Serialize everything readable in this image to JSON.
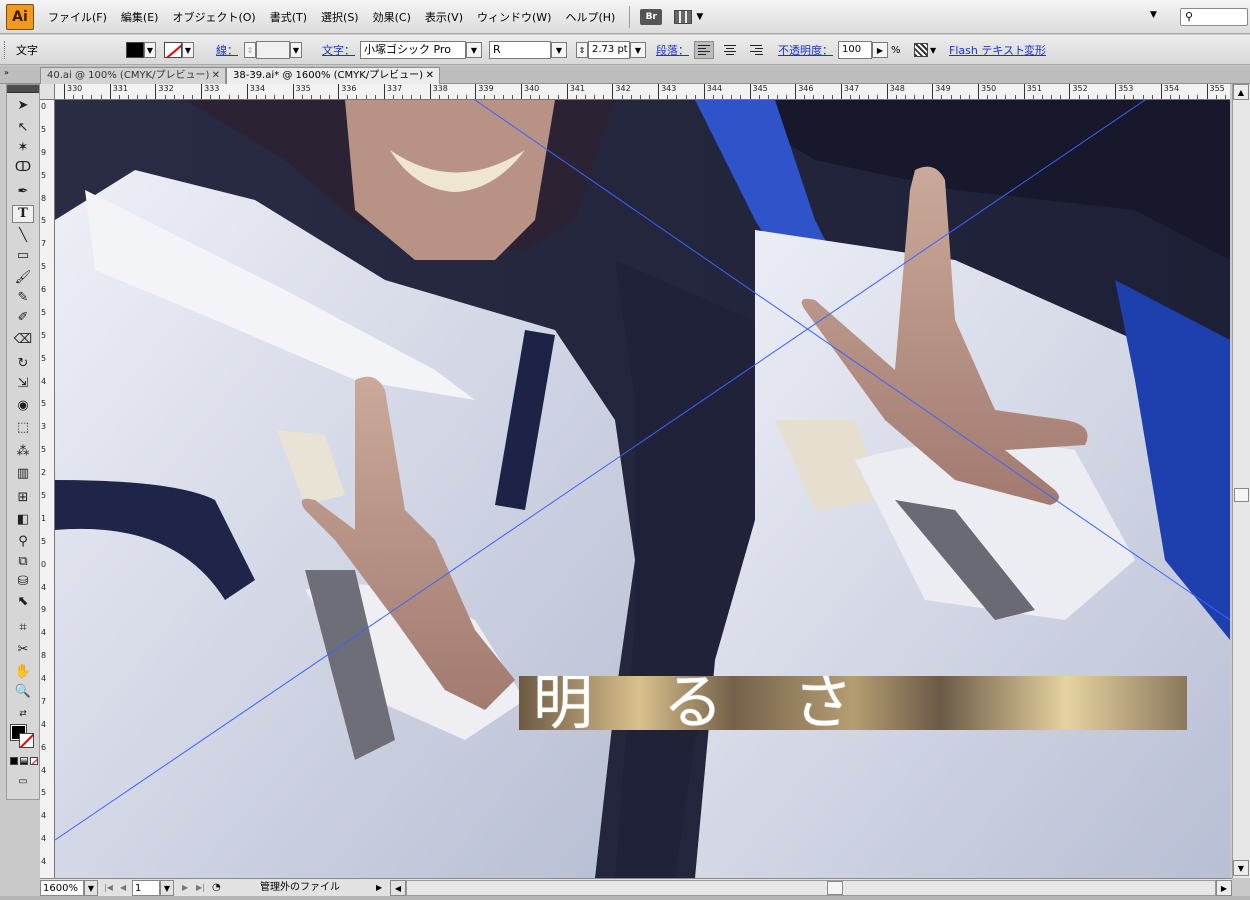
{
  "app": {
    "logo": "Ai"
  },
  "menubar": {
    "items": [
      "ファイル(F)",
      "編集(E)",
      "オブジェクト(O)",
      "書式(T)",
      "選択(S)",
      "効果(C)",
      "表示(V)",
      "ウィンドウ(W)",
      "ヘルプ(H)"
    ],
    "bridge_label": "Br"
  },
  "controlbar": {
    "tool_name": "文字",
    "stroke_label": "線：",
    "char_label": "文字：",
    "font_family": "小塚ゴシック Pro",
    "font_style": "R",
    "font_size": "2.73 pt",
    "paragraph_label": "段落：",
    "opacity_label": "不透明度：",
    "opacity_value": "100",
    "opacity_unit": "%",
    "flash_text_label": "Flash テキスト",
    "transform_label": "変形",
    "fill_color": "#000000",
    "stroke_color": "none"
  },
  "tabs": [
    {
      "label": "40.ai @ 100% (CMYK/プレビュー)",
      "active": false
    },
    {
      "label": "38-39.ai* @ 1600% (CMYK/プレビュー)",
      "active": true
    }
  ],
  "ruler": {
    "top_labels": [
      "330",
      "331",
      "332",
      "333",
      "334",
      "335",
      "336",
      "337",
      "338",
      "339",
      "340",
      "341",
      "342",
      "343",
      "344",
      "345",
      "346",
      "347",
      "348",
      "349",
      "350",
      "351",
      "352",
      "353",
      "354",
      "355"
    ],
    "left_labels": [
      "0",
      "5",
      "9",
      "5",
      "8",
      "5",
      "7",
      "5",
      "6",
      "5",
      "5",
      "5",
      "4",
      "5",
      "3",
      "5",
      "2",
      "5",
      "1",
      "5",
      "0",
      "4",
      "9",
      "4",
      "8",
      "4",
      "7",
      "4",
      "6",
      "4",
      "5",
      "4",
      "4",
      "4"
    ]
  },
  "canvas": {
    "banner_text": "明るさ",
    "guide_color": "#3a63ff"
  },
  "statusbar": {
    "zoom": "1600%",
    "artboard": "1",
    "status": "管理外のファイル"
  },
  "icons": {
    "stroke_none": "stroke-none-icon",
    "align_left": "align-left-icon",
    "align_center": "align-center-icon",
    "align_right": "align-right-icon",
    "search": "search-icon",
    "close": "close-icon"
  }
}
